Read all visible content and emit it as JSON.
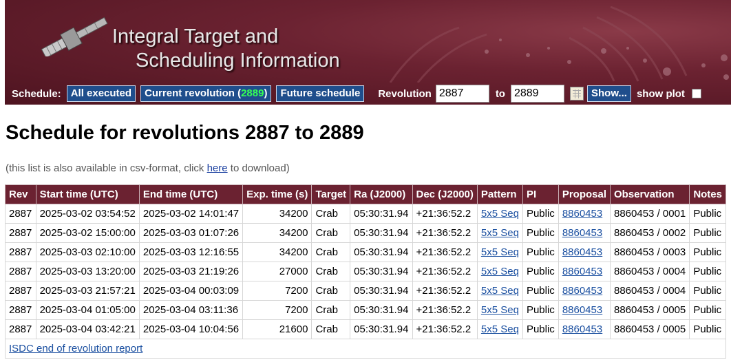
{
  "banner": {
    "title_line1": "Integral Target and",
    "title_line2": "Scheduling Information"
  },
  "controls": {
    "schedule_label": "Schedule:",
    "all_executed": "All executed",
    "current_revolution_prefix": "Current revolution (",
    "current_revolution_number": "2889",
    "current_revolution_suffix": ")",
    "future_schedule": "Future schedule",
    "revolution_label": "Revolution",
    "rev_from": "2887",
    "to_label": "to",
    "rev_to": "2889",
    "show_button": "Show...",
    "show_plot_label": "show plot",
    "show_plot_checked": false
  },
  "page": {
    "heading": "Schedule for revolutions 2887 to 2889",
    "csv_prefix": "(this list is also available in csv-format, click ",
    "csv_link": "here",
    "csv_suffix": " to download)"
  },
  "table": {
    "headers": [
      "Rev",
      "Start time (UTC)",
      "End time (UTC)",
      "Exp. time (s)",
      "Target",
      "Ra (J2000)",
      "Dec (J2000)",
      "Pattern",
      "PI",
      "Proposal",
      "Observation",
      "Notes"
    ],
    "rows": [
      [
        "2887",
        "2025-03-02 03:54:52",
        "2025-03-02 14:01:47",
        "34200",
        "Crab",
        "05:30:31.94",
        "+21:36:52.2",
        "5x5 Seq",
        "Public",
        "8860453",
        "8860453 / 0001",
        "Public"
      ],
      [
        "2887",
        "2025-03-02 15:00:00",
        "2025-03-03 01:07:26",
        "34200",
        "Crab",
        "05:30:31.94",
        "+21:36:52.2",
        "5x5 Seq",
        "Public",
        "8860453",
        "8860453 / 0002",
        "Public"
      ],
      [
        "2887",
        "2025-03-03 02:10:00",
        "2025-03-03 12:16:55",
        "34200",
        "Crab",
        "05:30:31.94",
        "+21:36:52.2",
        "5x5 Seq",
        "Public",
        "8860453",
        "8860453 / 0003",
        "Public"
      ],
      [
        "2887",
        "2025-03-03 13:20:00",
        "2025-03-03 21:19:26",
        "27000",
        "Crab",
        "05:30:31.94",
        "+21:36:52.2",
        "5x5 Seq",
        "Public",
        "8860453",
        "8860453 / 0004",
        "Public"
      ],
      [
        "2887",
        "2025-03-03 21:57:21",
        "2025-03-04 00:03:09",
        "7200",
        "Crab",
        "05:30:31.94",
        "+21:36:52.2",
        "5x5 Seq",
        "Public",
        "8860453",
        "8860453 / 0004",
        "Public"
      ],
      [
        "2887",
        "2025-03-04 01:05:00",
        "2025-03-04 03:11:36",
        "7200",
        "Crab",
        "05:30:31.94",
        "+21:36:52.2",
        "5x5 Seq",
        "Public",
        "8860453",
        "8860453 / 0005",
        "Public"
      ],
      [
        "2887",
        "2025-03-04 03:42:21",
        "2025-03-04 10:04:56",
        "21600",
        "Crab",
        "05:30:31.94",
        "+21:36:52.2",
        "5x5 Seq",
        "Public",
        "8860453",
        "8860453 / 0005",
        "Public"
      ]
    ],
    "footer_link": "ISDC end of revolution report"
  },
  "icons": {
    "satellite": "satellite-icon",
    "calendar": "calendar-icon"
  },
  "colors": {
    "banner": "#6b2231",
    "header_row": "#6b2231",
    "nav_button": "#1f4e8c",
    "current_rev_number": "#35ff55",
    "link": "#1a4fa0"
  }
}
